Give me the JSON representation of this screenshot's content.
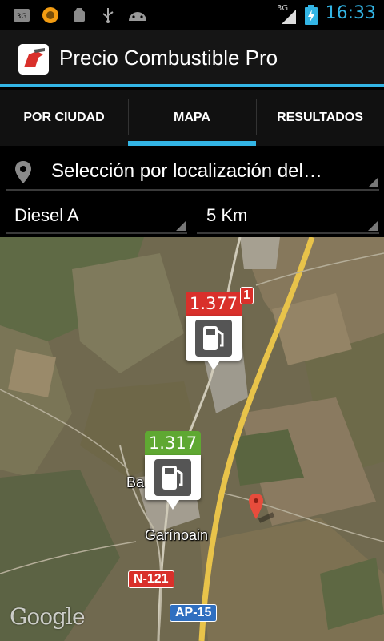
{
  "status_bar": {
    "time": "16:33",
    "network": "3G",
    "left_icons": [
      "3g-data-icon",
      "browser-icon",
      "android-debug-icon",
      "usb-icon",
      "android-icon"
    ],
    "accent": "#33b5e5"
  },
  "app": {
    "title": "Precio Combustible Pro",
    "icon": "fuel-nozzle-icon"
  },
  "tabs": [
    {
      "label": "POR CIUDAD",
      "active": false
    },
    {
      "label": "MAPA",
      "active": true
    },
    {
      "label": "RESULTADOS",
      "active": false
    }
  ],
  "filters": {
    "location": {
      "value": "Selección por localización del…",
      "icon": "location-pin-icon"
    },
    "fuel": {
      "value": "Diesel A"
    },
    "radius": {
      "value": "5 Km"
    }
  },
  "map": {
    "markers": [
      {
        "price": "1.377",
        "color": "#d9302b"
      },
      {
        "price": "1.317",
        "color": "#5fa832"
      }
    ],
    "places": {
      "ba": "Ba",
      "garinoain": "Garínoain"
    },
    "roads": {
      "n121": "N-121",
      "ap15": "AP-15",
      "partial": "1"
    },
    "attribution": "Google"
  }
}
